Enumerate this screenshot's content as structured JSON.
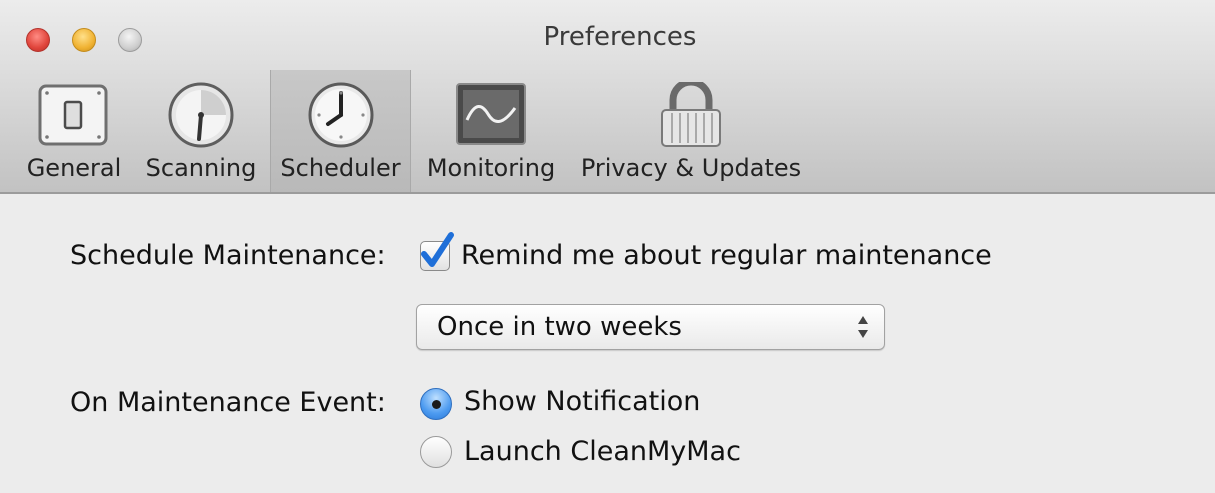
{
  "window": {
    "title": "Preferences"
  },
  "toolbar": {
    "tabs": [
      {
        "label": "General"
      },
      {
        "label": "Scanning"
      },
      {
        "label": "Scheduler"
      },
      {
        "label": "Monitoring"
      },
      {
        "label": "Privacy & Updates"
      }
    ],
    "selected_tab": "Scheduler"
  },
  "scheduler": {
    "schedule_maintenance_label": "Schedule Maintenance:",
    "remind_checkbox_label": "Remind me about regular maintenance",
    "remind_checked": true,
    "frequency_value": "Once in two weeks",
    "on_event_label": "On Maintenance Event:",
    "options": [
      {
        "label": "Show Notification",
        "selected": true
      },
      {
        "label": "Launch CleanMyMac",
        "selected": false
      }
    ]
  },
  "colors": {
    "checkmark": "#1f6fd8",
    "radio_selected": "#4d9bf0"
  }
}
